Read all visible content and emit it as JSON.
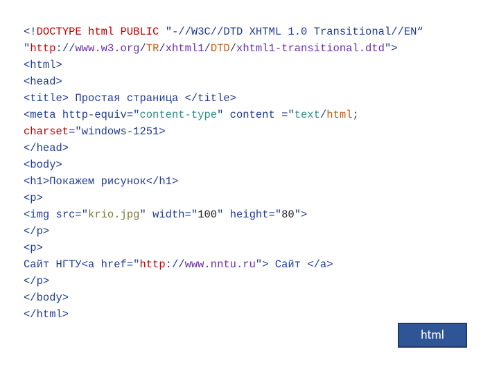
{
  "badge": {
    "label": "html"
  },
  "code": {
    "l1": {
      "a": "<!",
      "b": "DOCTYPE",
      "c": " ",
      "d": "html",
      "e": " ",
      "f": "PUBLIC",
      "g": " \"-//W3C//DTD XHTML 1.0 Transitional//EN“"
    },
    "l2": {
      "a": "\"",
      "b": "http",
      "c": "://",
      "d": "www.w3.org",
      "e": "/",
      "f": "TR",
      "g": "/",
      "h": "xhtml1",
      "i": "/",
      "j": "DTD",
      "k": "/",
      "l": "xhtml1-transitional.dtd",
      "m": "\">"
    },
    "l3": "<html>",
    "l4": "<head>",
    "l5": {
      "a": "<title>",
      "b": " Простая страница ",
      "c": "</title>"
    },
    "l6": {
      "a": "<meta ",
      "b": "http-equiv=\"",
      "c": "content-type",
      "d": "\" ",
      "e": "content",
      "f": " =\"",
      "g": "text",
      "h": "/",
      "i": "html",
      "j": ";"
    },
    "l7": {
      "a": "charset",
      "b": "=\"windows-1251>"
    },
    "l8": "</head>",
    "l9": "<body>",
    "l10": {
      "a": "<h1>",
      "b": "Покажем рисунок",
      "c": "</h1>"
    },
    "l11": "<p>",
    "l12": {
      "a": "<img ",
      "b": "src=\"",
      "c": "krio.jpg",
      "d": "\" ",
      "e": "width=\"",
      "f": "100",
      "g": "\" ",
      "h": "height=\"",
      "i": "80",
      "j": "\">"
    },
    "l13": "</p>",
    "l14": "<p>",
    "l15": {
      "a": "Сайт НГТУ",
      "b": "<a ",
      "c": "href=\"",
      "d": "http",
      "e": "://",
      "f": "www.nntu.ru",
      "g": "\">",
      "h": " Сайт ",
      "i": "</a>"
    },
    "l16": "</p>",
    "l17": "</body>",
    "l18": "</html>"
  }
}
